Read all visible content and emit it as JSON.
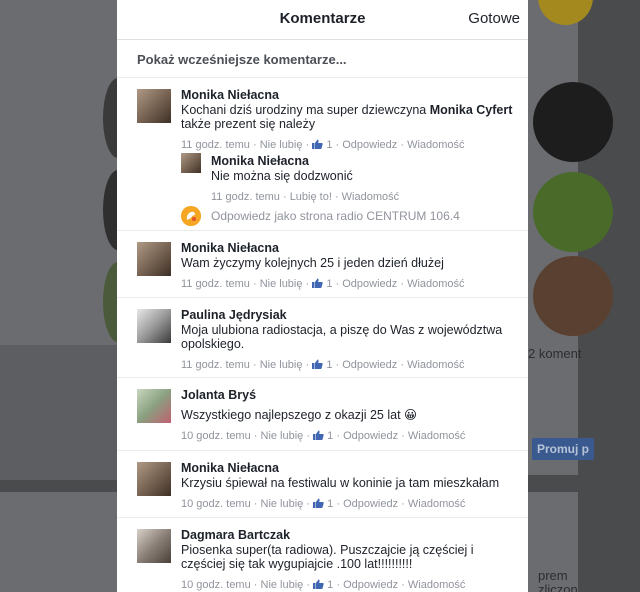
{
  "modal": {
    "title": "Komentarze",
    "done_label": "Gotowe",
    "show_earlier": "Pokaż wcześniejsze komentarze..."
  },
  "comments": [
    {
      "author": "Monika Niełacna",
      "text_before": "Kochani dziś urodziny ma super dziewczyna ",
      "tag": "Monika Cyfert",
      "text_after": " także prezent się należy",
      "time": "11 godz. temu",
      "unlike": "Nie lubię",
      "likes": "1",
      "reply": "Odpowiedz",
      "message": "Wiadomość",
      "replies": [
        {
          "author": "Monika Niełacna",
          "text": "Nie można się dodzwonić",
          "time": "11 godz. temu",
          "like": "Lubię to!",
          "message": "Wiadomość"
        }
      ],
      "reply_as": "Odpowiedz jako strona radio CENTRUM 106.4"
    },
    {
      "author": "Monika Niełacna",
      "text": "Wam życzymy kolejnych 25 i jeden dzień dłużej",
      "time": "11 godz. temu",
      "unlike": "Nie lubię",
      "likes": "1",
      "reply": "Odpowiedz",
      "message": "Wiadomość"
    },
    {
      "author": "Paulina Jędrysiak",
      "text": "Moja ulubiona radiostacja, a piszę do Was z województwa opolskiego.",
      "time": "11 godz. temu",
      "unlike": "Nie lubię",
      "likes": "1",
      "reply": "Odpowiedz",
      "message": "Wiadomość"
    },
    {
      "author": "Jolanta Bryś",
      "text": "Wszystkiego najlepszego z okazji 25 lat ",
      "emoji": "😀",
      "time": "10 godz. temu",
      "unlike": "Nie lubię",
      "likes": "1",
      "reply": "Odpowiedz",
      "message": "Wiadomość"
    },
    {
      "author": "Monika Niełacna",
      "text": "Krzysiu śpiewał na festiwalu w koninie ja tam mieszkałam",
      "time": "10 godz. temu",
      "unlike": "Nie lubię",
      "likes": "1",
      "reply": "Odpowiedz",
      "message": "Wiadomość"
    },
    {
      "author": "Dagmara Bartczak",
      "text": "Piosenka super(ta radiowa). Puszczajcie ją częściej i częściej się tak wygupiajcie .100 lat!!!!!!!!!!",
      "time": "10 godz. temu",
      "unlike": "Nie lubię",
      "likes": "1",
      "reply": "Odpowiedz",
      "message": "Wiadomość"
    }
  ],
  "background": {
    "right_fragment_1": "2 koment",
    "promote_button": "Promuj p",
    "right_fragment_2": "prem",
    "right_fragment_3": "zliczon"
  },
  "colors": {
    "accent_blue": "#4267b2",
    "meta_gray": "#90949c",
    "text_dark": "#1d2129",
    "page_icon": "#f5a623"
  },
  "icons": {
    "like": "thumbs-up-icon",
    "page": "radio-page-icon"
  }
}
